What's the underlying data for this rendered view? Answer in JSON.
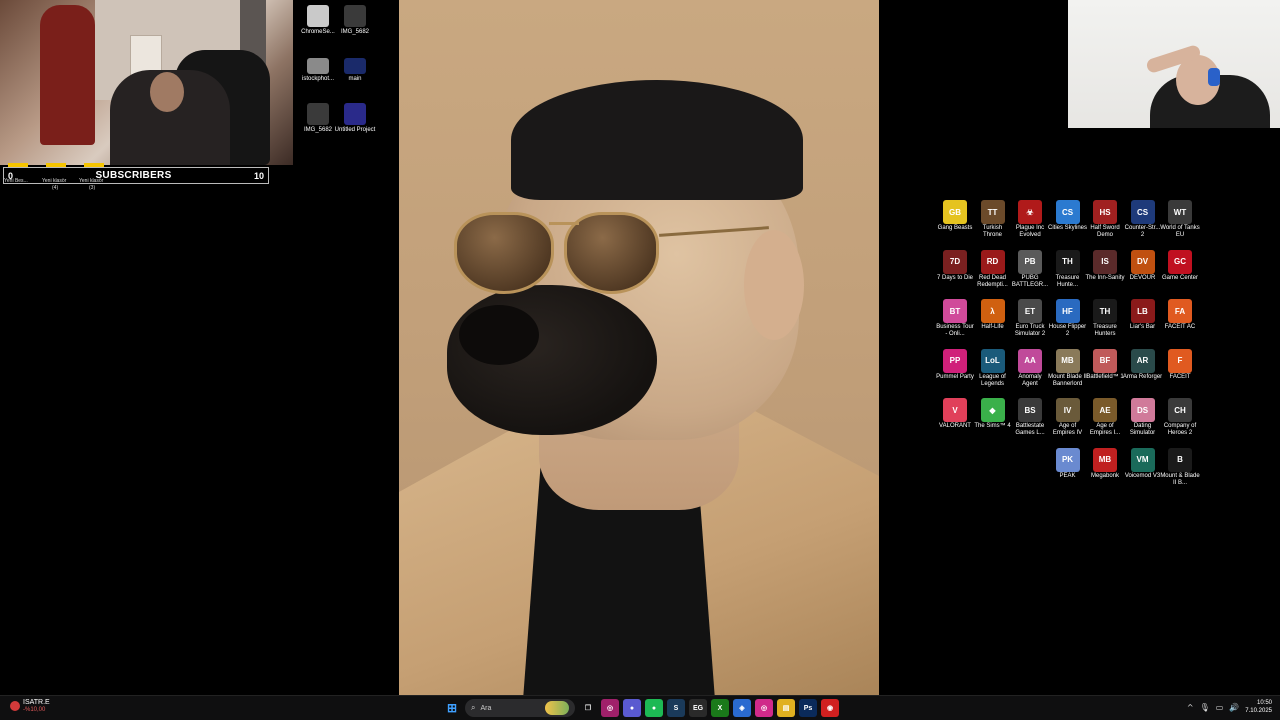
{
  "subscribers": {
    "start": "0",
    "title": "SUBSCRIBERS",
    "goal": "10",
    "markers": [
      {
        "label": "Yeni Bes...",
        "sub": ""
      },
      {
        "label": "Yeni klasör",
        "sub": "(4)"
      },
      {
        "label": "Yeni klasör",
        "sub": "(3)"
      }
    ]
  },
  "desktop_left_icons": [
    {
      "label": "ChromeSe...",
      "icon": "chrome-setup-icon",
      "color": "#c9c9c9"
    },
    {
      "label": "IMG_5682",
      "icon": "photo-icon",
      "color": "#3a3a3a"
    },
    {
      "label": "istockphot...",
      "icon": "image-icon",
      "color": "#8a8a8a"
    },
    {
      "label": "main",
      "icon": "video-icon",
      "color": "#1a2a6a"
    },
    {
      "label": "IMG_5682",
      "icon": "photo-icon",
      "color": "#3a3a3a"
    },
    {
      "label": "Untitled Project",
      "icon": "after-effects-icon",
      "color": "#2a2a8a"
    }
  ],
  "game_icons": [
    {
      "label": "Gang Beasts",
      "glyph": "GB",
      "color": "#e5c320"
    },
    {
      "label": "Turkish Throne",
      "glyph": "TT",
      "color": "#6b4a2a"
    },
    {
      "label": "Plague Inc Evolved",
      "glyph": "☣",
      "color": "#b01a1a"
    },
    {
      "label": "Cities Skylines",
      "glyph": "CS",
      "color": "#2b7ad0"
    },
    {
      "label": "Half Sword Demo",
      "glyph": "HS",
      "color": "#a02020"
    },
    {
      "label": "Counter-Str... 2",
      "glyph": "CS",
      "color": "#1e3a7a"
    },
    {
      "label": "World of Tanks EU",
      "glyph": "WT",
      "color": "#3a3a3a"
    },
    {
      "label": "7 Days to Die",
      "glyph": "7D",
      "color": "#7a2020"
    },
    {
      "label": "Red Dead Redempti...",
      "glyph": "RD",
      "color": "#9a1a1a"
    },
    {
      "label": "PUBG BATTLEGR...",
      "glyph": "PB",
      "color": "#5a5a5a"
    },
    {
      "label": "Treasure Hunte...",
      "glyph": "TH",
      "color": "#1a1a1a"
    },
    {
      "label": "The Inn-Sanity",
      "glyph": "IS",
      "color": "#5a2a2a"
    },
    {
      "label": "DEVOUR",
      "glyph": "DV",
      "color": "#c05010"
    },
    {
      "label": "Game Center",
      "glyph": "GC",
      "color": "#c01020"
    },
    {
      "label": "Business Tour - Onli...",
      "glyph": "BT",
      "color": "#d04a9a"
    },
    {
      "label": "Half-Life",
      "glyph": "λ",
      "color": "#d06010"
    },
    {
      "label": "Euro Truck Simulator 2",
      "glyph": "ET",
      "color": "#4a4a4a"
    },
    {
      "label": "House Flipper 2",
      "glyph": "HF",
      "color": "#2a6ac0"
    },
    {
      "label": "Treasure Hunters",
      "glyph": "TH",
      "color": "#1a1a1a"
    },
    {
      "label": "Liar's Bar",
      "glyph": "LB",
      "color": "#8a1a1a"
    },
    {
      "label": "FACEIT AC",
      "glyph": "FA",
      "color": "#e05a20"
    },
    {
      "label": "Pummel Party",
      "glyph": "PP",
      "color": "#d0207a"
    },
    {
      "label": "League of Legends",
      "glyph": "LoL",
      "color": "#1a5a7a"
    },
    {
      "label": "Anomaly Agent",
      "glyph": "AA",
      "color": "#c04a9a"
    },
    {
      "label": "Mount Blade II Bannerlord",
      "glyph": "MB",
      "color": "#8a7a5a"
    },
    {
      "label": "Battlefield™ 1",
      "glyph": "BF",
      "color": "#c05a5a"
    },
    {
      "label": "Arma Reforger",
      "glyph": "AR",
      "color": "#2a4a4a"
    },
    {
      "label": "FACEIT",
      "glyph": "F",
      "color": "#e05a20"
    },
    {
      "label": "VALORANT",
      "glyph": "V",
      "color": "#e0405a"
    },
    {
      "label": "The Sims™ 4",
      "glyph": "◆",
      "color": "#3ab04a"
    },
    {
      "label": "Battlestate Games L...",
      "glyph": "BS",
      "color": "#3a3a3a"
    },
    {
      "label": "Age of Empires IV",
      "glyph": "IV",
      "color": "#6a5a3a"
    },
    {
      "label": "Age of Empires I...",
      "glyph": "AE",
      "color": "#7a5a2a"
    },
    {
      "label": "Dating Simulator",
      "glyph": "DS",
      "color": "#d07a9a"
    },
    {
      "label": "Company of Heroes 2",
      "glyph": "CH",
      "color": "#3a3a3a"
    },
    {
      "label": "PEAK",
      "glyph": "PK",
      "color": "#6a8ad0"
    },
    {
      "label": "Megabonk",
      "glyph": "MB",
      "color": "#c02020"
    },
    {
      "label": "Voicemod V3",
      "glyph": "VM",
      "color": "#1a6a5a"
    },
    {
      "label": "Mount & Blade II B...",
      "glyph": "B",
      "color": "#1a1a1a"
    }
  ],
  "taskbar": {
    "weather_title": "ISATR.E",
    "weather_sub": "-%10,00",
    "search_label": "Ara",
    "apps": [
      {
        "glyph": "◎",
        "color": "#a0206a",
        "icon": "app-icon"
      },
      {
        "glyph": "●",
        "color": "#5a5ad0",
        "icon": "discord-icon"
      },
      {
        "glyph": "●",
        "color": "#1db954",
        "icon": "spotify-icon"
      },
      {
        "glyph": "S",
        "color": "#1a3a5a",
        "icon": "steam-icon"
      },
      {
        "glyph": "EG",
        "color": "#2a2a2a",
        "icon": "epic-games-icon"
      },
      {
        "glyph": "X",
        "color": "#1a7a1a",
        "icon": "xbox-icon"
      },
      {
        "glyph": "◈",
        "color": "#2a6ad0",
        "icon": "app-icon"
      },
      {
        "glyph": "◎",
        "color": "#d02a8a",
        "icon": "instagram-icon"
      },
      {
        "glyph": "▤",
        "color": "#e0b020",
        "icon": "file-explorer-icon"
      },
      {
        "glyph": "Ps",
        "color": "#0a2a5a",
        "icon": "photoshop-icon"
      },
      {
        "glyph": "◉",
        "color": "#d02020",
        "icon": "chrome-icon"
      }
    ],
    "time": "10:50",
    "date": "7.10.2025"
  }
}
